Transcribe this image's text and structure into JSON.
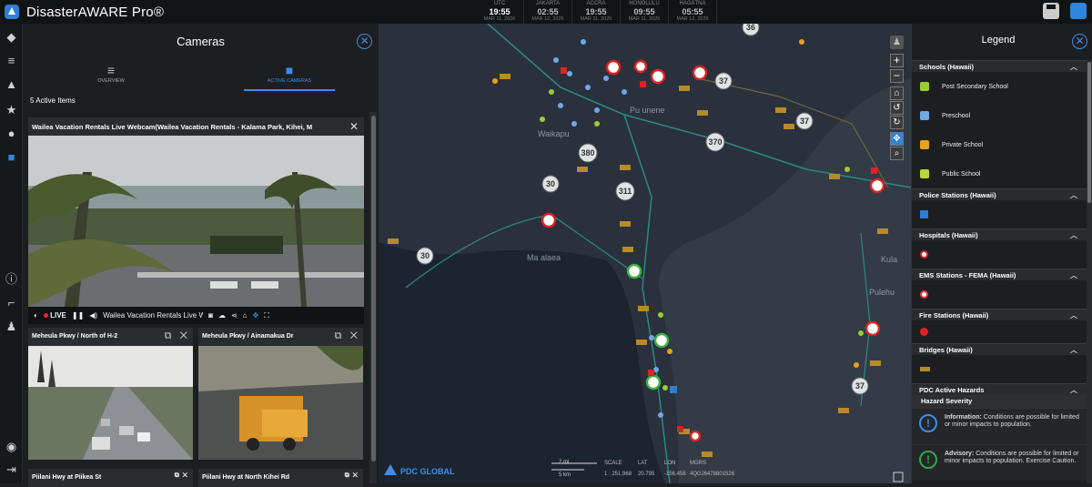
{
  "app": {
    "title": "DisasterAWARE Pro®"
  },
  "clocks": [
    {
      "city": "UTC",
      "time": "19:55",
      "date": "MAR 11, 2026"
    },
    {
      "city": "JAKARTA",
      "time": "02:55",
      "date": "MAR 12, 2026"
    },
    {
      "city": "ACCRA",
      "time": "19:55",
      "date": "MAR 11, 2026"
    },
    {
      "city": "HONOLULU",
      "time": "09:55",
      "date": "MAR 11, 2026"
    },
    {
      "city": "HAGÅTÑA",
      "time": "05:55",
      "date": "MAR 12, 2026"
    }
  ],
  "cameras_panel": {
    "title": "Cameras",
    "tabs": [
      {
        "label": "OVERVIEW",
        "icon": "hamburger-icon"
      },
      {
        "label": "ACTIVE CAMERAS",
        "icon": "video-camera-icon"
      }
    ],
    "active_count": "5 Active Items",
    "main_camera": {
      "title": "Wailea Vacation Rentals Live Webcam(Wailea Vacation Rentals - Kalama Park, Kihei, M",
      "live_label": "LIVE",
      "stream_name": "Wailea Vacation Rentals Live W"
    },
    "small_cameras": [
      {
        "title": "Meheula Pkwy / North of H-2"
      },
      {
        "title": "Meheula Pkwy / Ainamakua Dr"
      }
    ],
    "bottom_cameras": [
      {
        "title": "Piilani Hwy at Piikea St"
      },
      {
        "title": "Piilani Hwy at North Kihei Rd"
      }
    ]
  },
  "map": {
    "labels": [
      "Waikapu",
      "Pu unene",
      "Ma alaea",
      "Kula",
      "Pulehu"
    ],
    "routes": [
      "36",
      "37",
      "37",
      "380",
      "370",
      "30",
      "311",
      "30",
      "37"
    ],
    "scale": {
      "miles": "2 mi",
      "km": "5 km"
    },
    "footer": {
      "brand": "PDC GLOBAL",
      "scale_label": "SCALE",
      "scale_value": "1 : 251,968",
      "lat_label": "LAT",
      "lat_value": "20.795",
      "lon_label": "LON",
      "lon_value": "-156.456",
      "mgrs_label": "MGRS",
      "mgrs_value": "4QGJ6478801526"
    }
  },
  "legend": {
    "title": "Legend",
    "sections": [
      {
        "name": "Schools (Hawaii)",
        "items": [
          "Post Secondary School",
          "Preschool",
          "Private School",
          "Public School"
        ]
      },
      {
        "name": "Police Stations (Hawaii)"
      },
      {
        "name": "Hospitals (Hawaii)"
      },
      {
        "name": "EMS Stations - FEMA (Hawaii)"
      },
      {
        "name": "Fire Stations (Hawaii)"
      },
      {
        "name": "Bridges (Hawaii)"
      },
      {
        "name": "PDC Active Hazards"
      }
    ],
    "severity": {
      "heading": "Hazard Severity",
      "items": [
        {
          "name": "Information:",
          "text": "Conditions are possible for limited or minor impacts to population.",
          "color": "#3b8eea"
        },
        {
          "name": "Advisory:",
          "text": "Conditions are possible for limited or minor impacts to population. Exercise Caution.",
          "color": "#2fa84f"
        }
      ]
    }
  },
  "colors": {
    "accent": "#3b8eea",
    "panel": "#1d1e21",
    "map": "#252d38"
  }
}
